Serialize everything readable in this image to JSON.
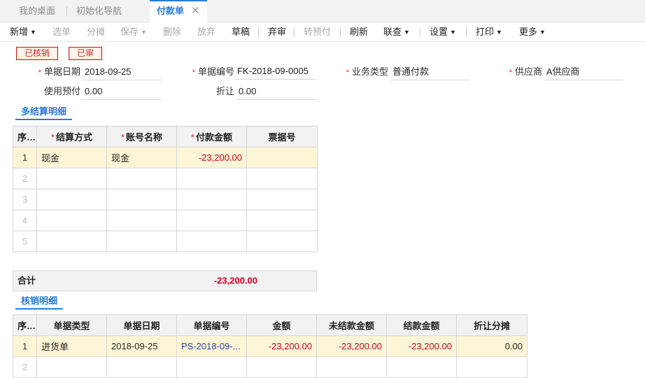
{
  "tabs": [
    {
      "label": "我的桌面"
    },
    {
      "label": "初始化导航"
    },
    {
      "label": "付款单",
      "close": "✕"
    }
  ],
  "toolbar": {
    "new": "新增",
    "pick": "选单",
    "split": "分摊",
    "save": "保存",
    "delete": "删除",
    "discard": "放弃",
    "draft": "草稿",
    "unaudit": "弃审",
    "prepay": "转预付",
    "refresh": "刷新",
    "linked": "联查",
    "settings": "设置",
    "print": "打印",
    "more": "更多",
    "caret": "▼"
  },
  "stamps": {
    "verified": "已核销",
    "audited": "已审"
  },
  "form": {
    "date_label": "单据日期",
    "date_value": "2018-09-25",
    "number_label": "单据编号",
    "number_value": "FK-2018-09-0005",
    "biztype_label": "业务类型",
    "biztype_value": "普通付款",
    "supplier_label": "供应商",
    "supplier_value": "A供应商",
    "prepay_label": "使用预付",
    "prepay_value": "0.00",
    "discount_label": "折让",
    "discount_value": "0.00",
    "required_mark": "*"
  },
  "settlement": {
    "title": "多结算明细",
    "columns": [
      "序号",
      "结算方式",
      "账号名称",
      "付款金额",
      "票据号"
    ],
    "rows": [
      {
        "no": "1",
        "method": "现金",
        "account": "现金",
        "amount": "-23,200.00",
        "bill": ""
      },
      {
        "no": "2",
        "method": "",
        "account": "",
        "amount": "",
        "bill": ""
      },
      {
        "no": "3",
        "method": "",
        "account": "",
        "amount": "",
        "bill": ""
      },
      {
        "no": "4",
        "method": "",
        "account": "",
        "amount": "",
        "bill": ""
      },
      {
        "no": "5",
        "method": "",
        "account": "",
        "amount": "",
        "bill": ""
      }
    ],
    "total_label": "合计",
    "total_value": "-23,200.00"
  },
  "writeoff": {
    "title": "核销明细",
    "columns": [
      "序号",
      "单据类型",
      "单据日期",
      "单据编号",
      "金额",
      "未结款金额",
      "结款金额",
      "折让分摊"
    ],
    "rows": [
      {
        "no": "1",
        "type": "进货单",
        "date": "2018-09-25",
        "number": "PS-2018-09-...",
        "amount": "-23,200.00",
        "unsettled": "-23,200.00",
        "settled": "-23,200.00",
        "discount": "0.00"
      },
      {
        "no": "2",
        "type": "",
        "date": "",
        "number": "",
        "amount": "",
        "unsettled": "",
        "settled": "",
        "discount": ""
      }
    ]
  }
}
